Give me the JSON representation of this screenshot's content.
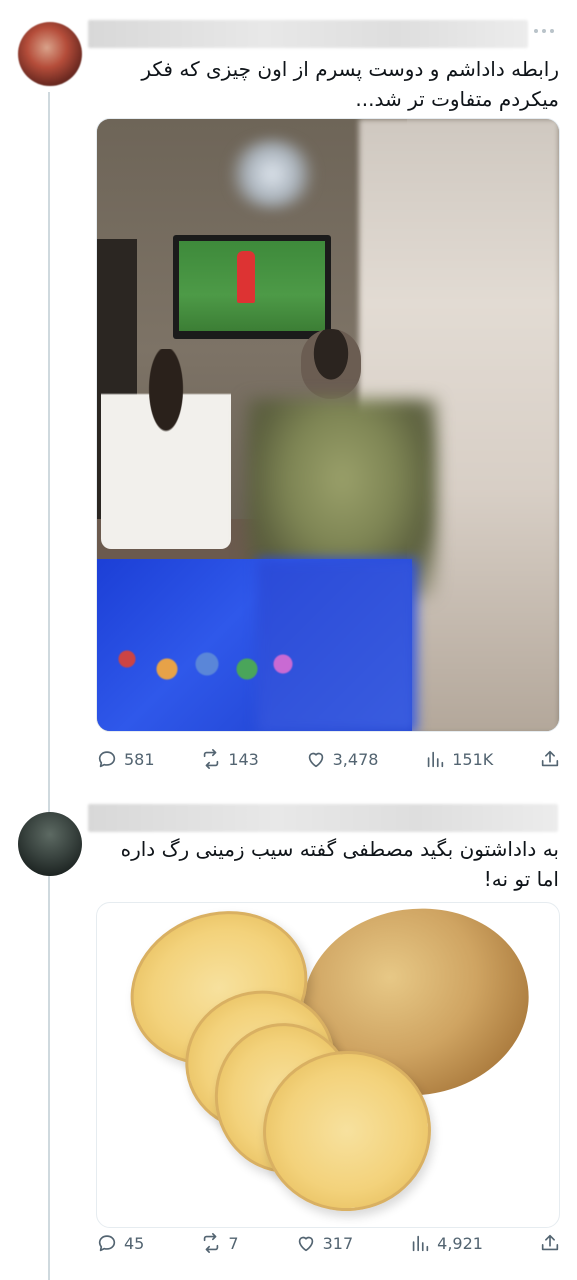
{
  "colors": {
    "text": "#0f1419",
    "muted": "#536471",
    "thread_line": "#cfd9de"
  },
  "tweets": [
    {
      "text_lines": [
        "رابطه داداشم و دوست پسرم از اون چیزی که فکر",
        "میکردم متفاوت تر شد..."
      ],
      "media_description_icon": "photo",
      "actions": {
        "replies": "581",
        "retweets": "143",
        "likes": "3,478",
        "views": "151K"
      }
    },
    {
      "text_lines": [
        "به داداشتون بگید مصطفی گفته سیب زمینی رگ داره",
        "اما تو نه!"
      ],
      "media_description_icon": "photo",
      "actions": {
        "replies": "45",
        "retweets": "7",
        "likes": "317",
        "views": "4,921"
      }
    }
  ]
}
